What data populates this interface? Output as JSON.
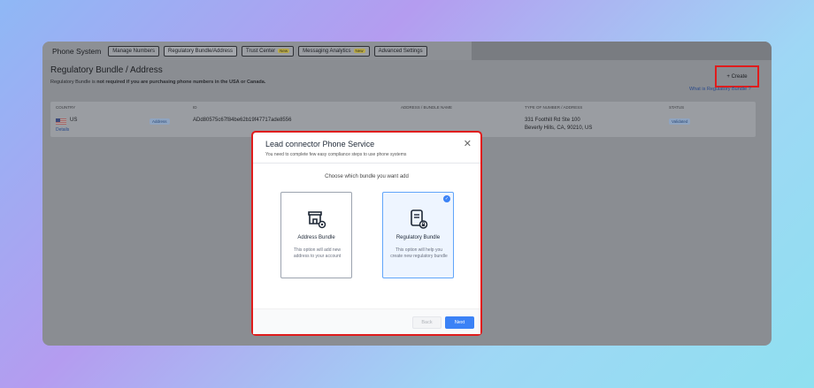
{
  "header": {
    "app_title": "Phone System",
    "tabs": [
      {
        "label": "Manage Numbers",
        "new": ""
      },
      {
        "label": "Regulatory Bundle/Address",
        "new": ""
      },
      {
        "label": "Trust Center",
        "new": "New"
      },
      {
        "label": "Messaging Analytics",
        "new": "New"
      },
      {
        "label": "Advanced Settings",
        "new": ""
      }
    ]
  },
  "page": {
    "title": "Regulatory Bundle / Address",
    "subtitle_prefix": "Regulatory Bundle is ",
    "subtitle_bold": "not required if you are purchasing phone numbers in the USA or Canada.",
    "create_label": "+ Create",
    "help_link": "What is Regulatory Bundle ?"
  },
  "table": {
    "headers": [
      "COUNTRY",
      "ID",
      "ADDRESS / BUNDLE NAME",
      "TYPE OF NUMBER / ADDRESS",
      "STATUS"
    ],
    "row": {
      "country": "US",
      "type_chip": "Address",
      "details": "Details",
      "id": "ADd80575c67f84be62b19f47717ade8556",
      "address_line1": "331 Foothill Rd Ste 100",
      "address_line2": "Beverly Hills, CA, 90210, US",
      "status": "Validated"
    }
  },
  "modal": {
    "title": "Lead connector Phone Service",
    "subtitle": "You need to complete few easy compliance steps to use phone systems",
    "close_icon": "close-icon",
    "prompt": "Choose which bundle you want add",
    "cards": [
      {
        "title": "Address Bundle",
        "desc": "This option will add new address to your account",
        "icon": "store-icon",
        "selected": false
      },
      {
        "title": "Regulatory Bundle",
        "desc": "This option will help you create new regulatory bundle",
        "icon": "document-lock-icon",
        "selected": true
      }
    ],
    "back_label": "Back",
    "next_label": "Next"
  },
  "colors": {
    "accent": "#3b82f6",
    "highlight": "#e01c1c"
  }
}
